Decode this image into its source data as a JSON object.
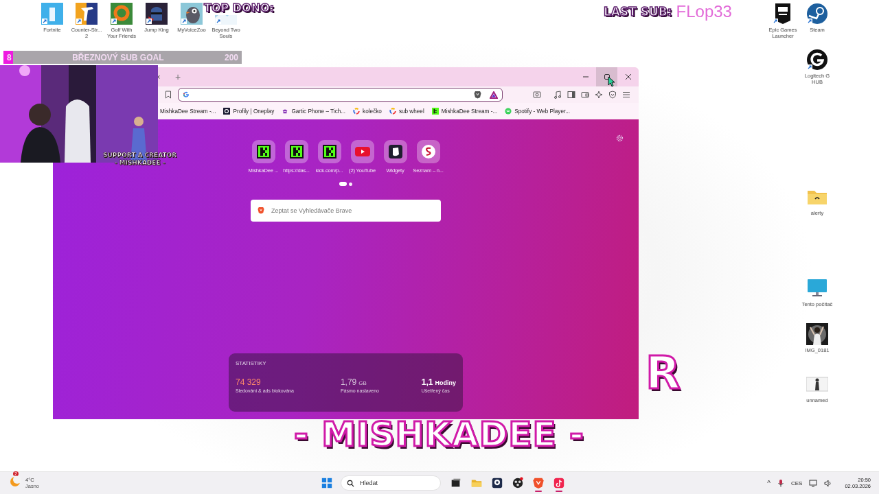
{
  "desktop": {
    "icons_top": [
      {
        "label": "Fortnite",
        "kind": "fortnite"
      },
      {
        "label": "Counter-Str... 2",
        "kind": "counter"
      },
      {
        "label": "Golf With Your Friends",
        "kind": "golf"
      },
      {
        "label": "Jump King",
        "kind": "knight"
      },
      {
        "label": "MyVoiceZoo",
        "kind": "penguin"
      },
      {
        "label": "Beyond Two Souls",
        "kind": "landscape"
      }
    ],
    "icons_right": [
      {
        "label": "Epic Games Launcher",
        "kind": "epic"
      },
      {
        "label": "Steam",
        "kind": "steam"
      },
      {
        "label": "Logitech G HUB",
        "kind": "logi"
      },
      {
        "label": "alerty",
        "kind": "folder"
      },
      {
        "label": "Tento počítač",
        "kind": "monitor"
      },
      {
        "label": "IMG_0181"
      },
      {
        "label": "unnamed",
        "kind": "photo_small"
      }
    ]
  },
  "overlay": {
    "top_dono_label": "TOP DONO:",
    "last_sub_label": "LAST SUB:",
    "last_sub_name": "FLop33",
    "sub_goal": {
      "current": "8",
      "title": "BŘEZNOVÝ SUB GOAL",
      "target": "200",
      "level": 0.04
    },
    "webcam": {
      "kind": "picture",
      "caption": [
        "SUPPORT A CREATOR",
        "- MISHKADEE -"
      ]
    },
    "banner": {
      "fragment": "R",
      "name": "- MISHKADEE -"
    }
  },
  "browser": {
    "tab_close": "×",
    "new_tab": "+",
    "bookmarks": [
      {
        "label": "MishkaDee Stream -..."
      },
      {
        "label": "Profily | Oneplay",
        "kind": "oneplay"
      },
      {
        "label": "Gartic Phone – Tich...",
        "kind": "phone"
      },
      {
        "label": "kolečko",
        "kind": "wheel"
      },
      {
        "label": "sub wheel",
        "kind": "wheel"
      },
      {
        "label": "MishkaDee Stream -...",
        "kind": "kick"
      },
      {
        "label": "Spotify - Web Player...",
        "kind": "spotify"
      }
    ],
    "tiles": [
      {
        "label": "MishkaDee ...",
        "kind": "kick"
      },
      {
        "label": "https://das...",
        "kind": "kick"
      },
      {
        "label": "kick.com/p...",
        "kind": "kick"
      },
      {
        "label": "(2) YouTube",
        "kind": "youtube"
      },
      {
        "label": "Widgety",
        "kind": "widget"
      },
      {
        "label": "Seznam – n...",
        "kind": "seznam"
      }
    ],
    "pager": [
      {
        "selected": true
      },
      {
        "selected": false
      }
    ],
    "search": {
      "placeholder": "Zeptat se Vyhledávače Brave"
    },
    "stats": {
      "title": "STATISTIKY",
      "items": [
        {
          "value": "74 329",
          "label": "Sledování & ads blokována",
          "kind": "highlight"
        },
        {
          "value": "1,79",
          "unit": "GB",
          "label": "Pásmo nastaveno",
          "kind": "plain"
        },
        {
          "value": "1,1",
          "unit": "Hodiny",
          "label": "Ušetřený čas",
          "kind": "strong"
        }
      ]
    }
  },
  "taskbar": {
    "weather": {
      "badge": "2",
      "temperature": "4°C",
      "condition": "Jasno"
    },
    "search": {
      "placeholder": "Hledat"
    },
    "apps": [
      {
        "kind": "windows",
        "active": false
      },
      {
        "kind": "taskview",
        "active": false
      },
      {
        "kind": "folder",
        "active": false
      },
      {
        "kind": "camera",
        "active": false
      },
      {
        "kind": "obs",
        "active": false
      },
      {
        "kind": "brave",
        "active": true
      },
      {
        "kind": "tiktok",
        "active": true
      }
    ],
    "tray": {
      "overflow": "^",
      "language": "CES",
      "time": "20:50",
      "date": "02.03.2026"
    }
  }
}
